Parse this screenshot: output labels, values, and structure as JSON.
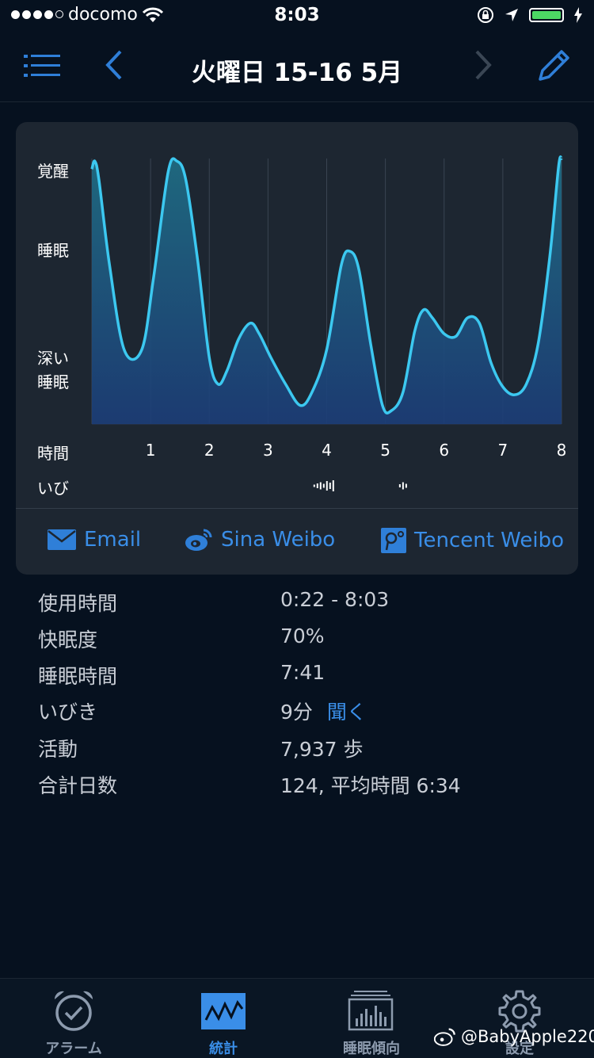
{
  "status_bar": {
    "carrier": "docomo",
    "time": "8:03"
  },
  "header": {
    "title": "火曜日 15-16 5月"
  },
  "chart_data": {
    "type": "area",
    "y_levels": [
      "覚醒",
      "睡眠",
      "深い睡眠"
    ],
    "y_levels_display": {
      "awake": "覚醒",
      "sleep": "睡眠",
      "deep1": "深い",
      "deep2": "睡眠"
    },
    "x_title": "時間",
    "x_ticks": [
      "1",
      "2",
      "3",
      "4",
      "5",
      "6",
      "7",
      "8"
    ],
    "snore_title": "いび",
    "y_range": [
      0,
      1
    ],
    "x_range": [
      0,
      8
    ],
    "series": [
      {
        "x": [
          0,
          0.05,
          0.12,
          0.3,
          0.55,
          0.85,
          1.05,
          1.3,
          1.45,
          1.6,
          1.8,
          2.0,
          2.15,
          2.3,
          2.5,
          2.7,
          2.85,
          3.05,
          3.3,
          3.55,
          3.75,
          4.0,
          4.25,
          4.4,
          4.55,
          4.75,
          4.95,
          5.1,
          5.3,
          5.5,
          5.65,
          5.8,
          6.0,
          6.2,
          6.4,
          6.6,
          6.8,
          7.0,
          7.2,
          7.4,
          7.6,
          7.8,
          7.95,
          8.0
        ],
        "y": [
          0.96,
          0.99,
          0.92,
          0.6,
          0.28,
          0.28,
          0.55,
          0.95,
          0.99,
          0.92,
          0.62,
          0.25,
          0.15,
          0.2,
          0.32,
          0.38,
          0.34,
          0.25,
          0.15,
          0.07,
          0.12,
          0.28,
          0.6,
          0.65,
          0.58,
          0.3,
          0.07,
          0.05,
          0.12,
          0.35,
          0.43,
          0.4,
          0.34,
          0.33,
          0.4,
          0.38,
          0.23,
          0.14,
          0.11,
          0.15,
          0.3,
          0.63,
          0.97,
          1.0
        ]
      }
    ],
    "snore_events": [
      {
        "x": 3.95,
        "size": "large"
      },
      {
        "x": 5.3,
        "size": "small"
      }
    ]
  },
  "share": {
    "email": "Email",
    "sina": "Sina Weibo",
    "tencent": "Tencent Weibo"
  },
  "details": {
    "usage_label": "使用時間",
    "usage_value": "0:22 - 8:03",
    "quality_label": "快眠度",
    "quality_value": "70%",
    "sleep_label": "睡眠時間",
    "sleep_value": "7:41",
    "snore_label": "いびき",
    "snore_value": "9分",
    "listen_label": "聞く",
    "activity_label": "活動",
    "activity_value": "7,937 歩",
    "total_label": "合計日数",
    "total_value": "124, 平均時間 6:34"
  },
  "tabs": [
    {
      "label": "アラーム",
      "icon": "alarm-clock-icon"
    },
    {
      "label": "統計",
      "icon": "graph-icon"
    },
    {
      "label": "睡眠傾向",
      "icon": "bar-chart-icon"
    },
    {
      "label": "設定",
      "icon": "gear-icon"
    }
  ],
  "watermark": "@BabyApple220",
  "colors": {
    "accent": "#3a8ee8",
    "line": "#3cc8f0",
    "background": "#06111f",
    "card": "#1d2631",
    "battery": "#4cd964"
  }
}
